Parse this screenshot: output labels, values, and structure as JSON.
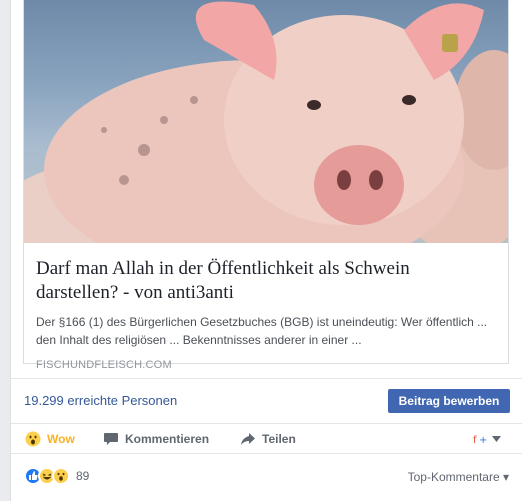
{
  "card": {
    "title": "Darf man Allah in der Öffentlichkeit als Schwein darstellen? - von anti3anti",
    "description": "Der §166 (1) des Bürgerlichen Gesetzbuches (BGB) ist uneindeutig: Wer öffentlich ... den Inhalt des religiösen ... Bekenntnisses anderer in einer ...",
    "domain": "FISCHUNDFLEISCH.COM",
    "image_icon": "pig-photo"
  },
  "reach": {
    "text": "19.299 erreichte Personen",
    "button_label": "Beitrag bewerben"
  },
  "actions": {
    "wow": "Wow",
    "comment": "Kommentieren",
    "share": "Teilen",
    "viewer_icon": "page-avatar-icon"
  },
  "summary": {
    "reactions": [
      "like-icon",
      "haha-icon",
      "wow-icon"
    ],
    "count": "89",
    "sort_label": "Top-Kommentare ▾"
  },
  "colors": {
    "link": "#365899",
    "button": "#4267b2",
    "wow": "#f7b125",
    "muted": "#606770"
  }
}
